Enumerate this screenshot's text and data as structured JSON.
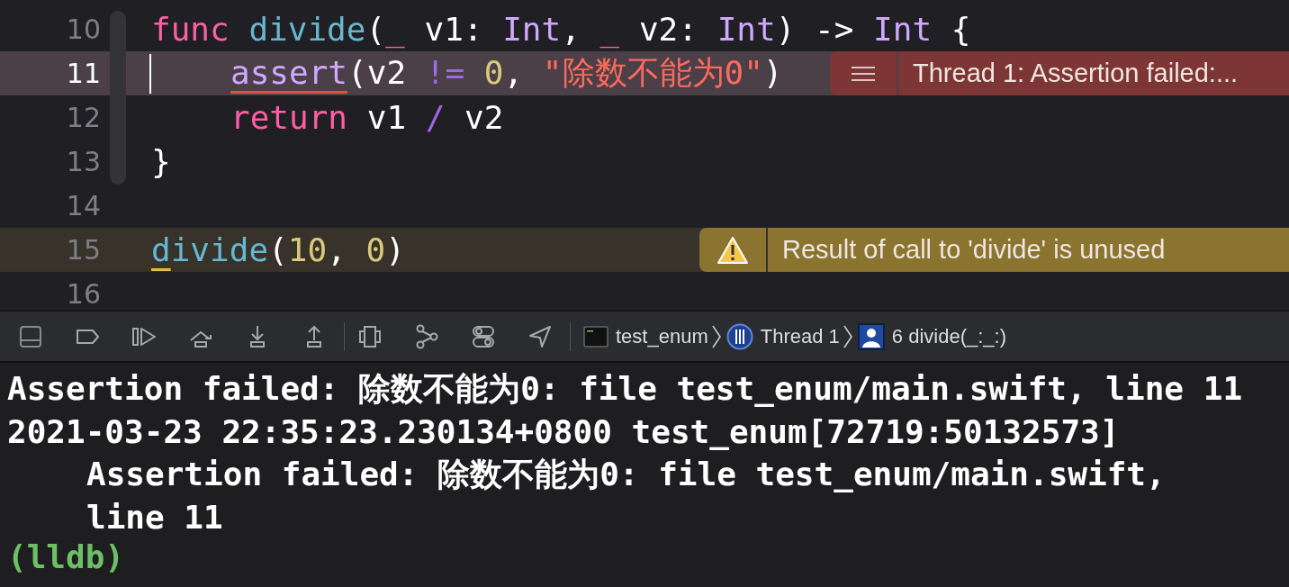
{
  "editor": {
    "lines": [
      {
        "number": "10",
        "current": false,
        "tokens": [
          {
            "text": "func ",
            "kind": "keyword"
          },
          {
            "text": "divide",
            "kind": "function"
          },
          {
            "text": "(",
            "kind": "plain"
          },
          {
            "text": "_",
            "kind": "keyword"
          },
          {
            "text": " v1: ",
            "kind": "plain"
          },
          {
            "text": "Int",
            "kind": "type"
          },
          {
            "text": ", ",
            "kind": "plain"
          },
          {
            "text": "_",
            "kind": "keyword"
          },
          {
            "text": " v2: ",
            "kind": "plain"
          },
          {
            "text": "Int",
            "kind": "type"
          },
          {
            "text": ") -> ",
            "kind": "plain"
          },
          {
            "text": "Int",
            "kind": "type"
          },
          {
            "text": " {",
            "kind": "plain"
          }
        ],
        "children": [
          {
            "number": "11",
            "current": true,
            "tokens": [
              {
                "text": "assert",
                "kind": "type",
                "underlined": true
              },
              {
                "text": "(v2 ",
                "kind": "plain"
              },
              {
                "text": "!= ",
                "kind": "operator"
              },
              {
                "text": "0",
                "kind": "number"
              },
              {
                "text": ", ",
                "kind": "plain"
              },
              {
                "text": "\"除数不能为0\"",
                "kind": "string"
              },
              {
                "text": ")",
                "kind": "plain"
              }
            ],
            "issue": {
              "kind": "error",
              "message": "Thread 1: Assertion failed:..."
            }
          },
          {
            "number": "12",
            "current": false,
            "tokens": [
              {
                "text": "return",
                "kind": "keyword"
              },
              {
                "text": " v1 ",
                "kind": "plain"
              },
              {
                "text": "/",
                "kind": "operator"
              },
              {
                "text": " v2",
                "kind": "plain"
              }
            ]
          }
        ]
      },
      {
        "number": "13",
        "current": false,
        "tokens": [
          {
            "text": "}",
            "kind": "plain"
          }
        ]
      },
      {
        "number": "14",
        "current": false
      },
      {
        "number": "15",
        "current": false,
        "tokens": [
          {
            "text": "d",
            "kind": "function",
            "underlined": true
          },
          {
            "text": "ivide",
            "kind": "function"
          },
          {
            "text": "(",
            "kind": "plain"
          },
          {
            "text": "10",
            "kind": "number"
          },
          {
            "text": ", ",
            "kind": "plain"
          },
          {
            "text": "0",
            "kind": "number"
          },
          {
            "text": ")",
            "kind": "plain"
          }
        ],
        "issue": {
          "kind": "warning",
          "message": "Result of call to 'divide' is unused"
        }
      },
      {
        "number": "16",
        "current": false
      }
    ]
  },
  "debug_bar": {
    "breadcrumbs": [
      {
        "kind": "target",
        "label": "test_enum"
      },
      {
        "kind": "thread",
        "label": "Thread 1"
      },
      {
        "kind": "frame",
        "label": "6 divide(_:_:)"
      }
    ]
  },
  "console": {
    "lines": [
      {
        "kind": "output",
        "text": "Assertion failed: 除数不能为0: file test_enum/main.swift, line 11"
      },
      {
        "kind": "output",
        "text": "2021-03-23 22:35:23.230134+0800 test_enum[72719:50132573]"
      },
      {
        "kind": "continuation",
        "text": "Assertion failed: 除数不能为0: file test_enum/main.swift,"
      },
      {
        "kind": "continuation",
        "text": "line 11"
      },
      {
        "kind": "prompt",
        "text": "(lldb)"
      }
    ]
  }
}
